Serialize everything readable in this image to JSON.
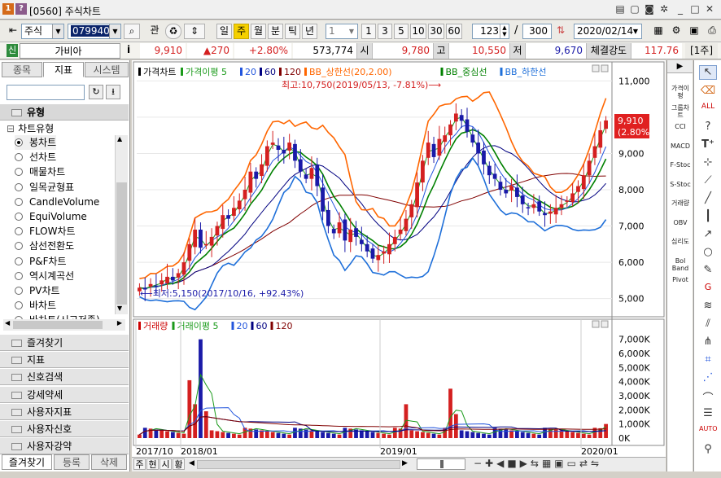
{
  "window": {
    "title": "[0560] 주식차트"
  },
  "toolbar": {
    "market_select": "주식",
    "code": "079940",
    "btn_related": "관",
    "periods": [
      "일",
      "주",
      "월",
      "분",
      "틱",
      "년"
    ],
    "period_active": "주",
    "tick_value": "1",
    "quick_nums": [
      "1",
      "3",
      "5",
      "10",
      "30",
      "60"
    ],
    "count1": "123",
    "count2": "300",
    "date": "2020/02/14"
  },
  "quote": {
    "badge": "신",
    "name": "가비아",
    "info_icon": "i",
    "price": "9,910",
    "change": "▲270",
    "rate": "+2.80%",
    "volume": "573,774",
    "open_label": "시",
    "open": "9,780",
    "high_label": "고",
    "high": "10,550",
    "low_label": "저",
    "low": "9,670",
    "strength_label": "체결강도",
    "strength": "117.76",
    "unit": "[1주]"
  },
  "left": {
    "tabs": [
      "종목",
      "지표",
      "시스템"
    ],
    "active_tab": "지표",
    "section_title": "유형",
    "tree_root": "차트유형",
    "items": [
      "봉차트",
      "선차트",
      "매물차트",
      "일목균형표",
      "CandleVolume",
      "EquiVolume",
      "FLOW차트",
      "삼선전환도",
      "P&F차트",
      "역시계곡선",
      "PV차트",
      "바차트",
      "바차트(시고저종)"
    ],
    "selected_item": "봉차트",
    "folders": [
      "즐겨찾기",
      "지표",
      "신호검색",
      "강세약세",
      "사용자지표",
      "사용자신호",
      "사용자강약"
    ],
    "bottom_tabs": [
      "즐겨찾기",
      "등록",
      "삭제"
    ]
  },
  "price_panel": {
    "legend": [
      {
        "label": "가격차트",
        "color": "#000000"
      },
      {
        "label": "가격이평 5",
        "color": "#1a9a1a"
      },
      {
        "label": "20",
        "color": "#2255dd"
      },
      {
        "label": "60",
        "color": "#000080"
      },
      {
        "label": "120",
        "color": "#800000"
      },
      {
        "label": "BB_상한선(20,2.00)",
        "color": "#ff6600"
      },
      {
        "label": "BB_중심선",
        "color": "#008000"
      },
      {
        "label": "BB_하한선",
        "color": "#1e6fd9"
      }
    ],
    "max_note": "최고:10,750(2019/05/13, -7.81%)⟶",
    "min_note": "⟵최저:5,150(2017/10/16, +92.43%)",
    "last_price": "9,910",
    "last_rate": "(2.80%)",
    "yticks": [
      "11,000",
      "10,000",
      "9,000",
      "8,000",
      "7,000",
      "6,000",
      "5,000"
    ]
  },
  "volume_panel": {
    "legend": [
      {
        "label": "거래량",
        "color": "#cc0000"
      },
      {
        "label": "거래이평 5",
        "color": "#1a9a1a"
      },
      {
        "label": "20",
        "color": "#2255dd"
      },
      {
        "label": "60",
        "color": "#000080"
      },
      {
        "label": "120",
        "color": "#800000"
      }
    ],
    "yticks": [
      "7,000K",
      "6,000K",
      "5,000K",
      "4,000K",
      "3,000K",
      "2,000K",
      "1,000K",
      "0K"
    ]
  },
  "xaxis": [
    "2017/10",
    "2018/01",
    "2019/01",
    "2020/01"
  ],
  "bottom_bar": {
    "tabs": [
      "주",
      "현",
      "시",
      "황"
    ]
  },
  "right_tools": [
    "가격이평",
    "그룹차트",
    "CCI",
    "MACD",
    "F-Stoc",
    "S-Stoc",
    "거래량",
    "OBV",
    "심리도",
    "Bol Band",
    "Pivot"
  ],
  "colors": {
    "up": "#d42020",
    "down": "#1a1aa8",
    "accent": "#ff0000"
  },
  "chart_data": {
    "type": "candlestick",
    "title": "가격차트",
    "x_range": [
      "2017/10",
      "2020/02"
    ],
    "ylim": [
      4700,
      11300
    ],
    "approx_closes_weekly": [
      5300,
      5250,
      5400,
      5350,
      5500,
      5600,
      5500,
      5700,
      6000,
      6500,
      6900,
      6400,
      6500,
      6700,
      7000,
      7300,
      7200,
      7500,
      7700,
      8000,
      8500,
      8300,
      8700,
      9200,
      9300,
      9100,
      9000,
      9300,
      8800,
      8500,
      8300,
      8600,
      8100,
      7400,
      7000,
      6800,
      7100,
      6600,
      6900,
      6700,
      6500,
      6300,
      6100,
      6200,
      6300,
      6500,
      6700,
      6900,
      7200,
      7600,
      8200,
      8800,
      9300,
      8900,
      9400,
      9500,
      9800,
      10100,
      9900,
      9600,
      9300,
      9000,
      8700,
      8400,
      8300,
      8000,
      7900,
      8100,
      7800,
      7600,
      7500,
      7600,
      7400,
      7300,
      7400,
      7500,
      7600,
      7700,
      7900,
      8100,
      8400,
      8800,
      9200,
      9640,
      9910
    ],
    "volume_peaks_k": [
      {
        "x": "2018/01",
        "v": 4100
      },
      {
        "x": "2018/02",
        "v": 7000
      },
      {
        "x": "2019/01",
        "v": 2400
      },
      {
        "x": "2019/05",
        "v": 3500
      },
      {
        "x": "2020/02",
        "v": 1000
      }
    ]
  }
}
